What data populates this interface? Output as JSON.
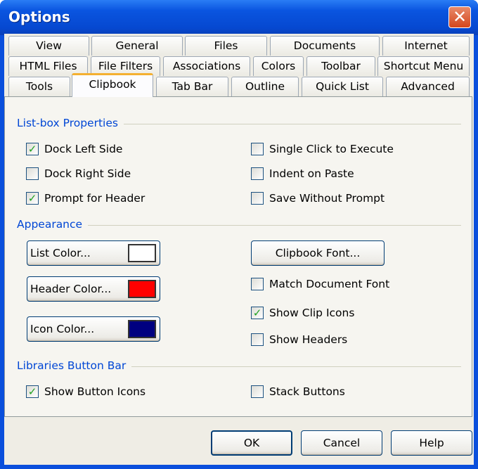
{
  "window": {
    "title": "Options",
    "close": "✕"
  },
  "tabs": {
    "row1": [
      "View",
      "General",
      "Files",
      "Documents",
      "Internet"
    ],
    "row2": [
      "HTML Files",
      "File Filters",
      "Associations",
      "Colors",
      "Toolbar",
      "Shortcut Menu"
    ],
    "row3": [
      "Tools",
      "Clipbook",
      "Tab Bar",
      "Outline",
      "Quick List",
      "Advanced"
    ],
    "selected": "Clipbook"
  },
  "listbox": {
    "heading": "List-box Properties",
    "options": [
      {
        "label": "Dock Left Side",
        "checked": true
      },
      {
        "label": "Dock Right Side",
        "checked": false
      },
      {
        "label": "Prompt for Header",
        "checked": true
      },
      {
        "label": "Single Click to Execute",
        "checked": false
      },
      {
        "label": "Indent on Paste",
        "checked": false
      },
      {
        "label": "Save Without Prompt",
        "checked": false
      }
    ]
  },
  "appearance": {
    "heading": "Appearance",
    "color_buttons": [
      {
        "label": "List Color...",
        "color": "#FFFFFF"
      },
      {
        "label": "Header Color...",
        "color": "#FF0000"
      },
      {
        "label": "Icon Color...",
        "color": "#000080"
      }
    ],
    "font_button": "Clipbook Font...",
    "options": [
      {
        "label": "Match Document Font",
        "checked": false
      },
      {
        "label": "Show Clip Icons",
        "checked": true
      },
      {
        "label": "Show Headers",
        "checked": false
      }
    ]
  },
  "libraries": {
    "heading": "Libraries Button Bar",
    "options": [
      {
        "label": "Show Button Icons",
        "checked": true
      },
      {
        "label": "Stack Buttons",
        "checked": false
      }
    ]
  },
  "footer": {
    "ok": "OK",
    "cancel": "Cancel",
    "help": "Help"
  }
}
